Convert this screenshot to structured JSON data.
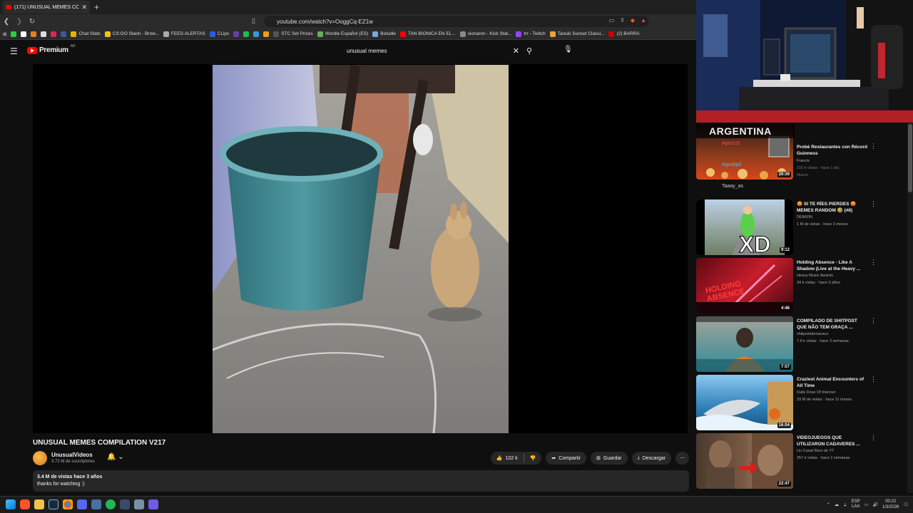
{
  "browser": {
    "tab_title": "(171) UNUSUAL MEMES COM",
    "url": "youtube.com/watch?v=OoggCq-EZ1w",
    "bookmarks": [
      "Chat Stats",
      "CS:GO Stash - Brow...",
      "FEED ALERTAS",
      "CLips",
      "STC Set Prices",
      "Wordle Español (ES)",
      "Boludle",
      "TAN BIONICA EN EL...",
      "sionaron - Kick Stat...",
      "trr - Twitch",
      "Tanuki Sunset Classi...",
      "(2) BARRA"
    ]
  },
  "youtube": {
    "logo_text": "Premium",
    "logo_sup": "AR",
    "search_query": "unusual memes"
  },
  "video": {
    "title": "UNUSUAL MEMES COMPILATION V217",
    "channel": "UnusualVideos",
    "subscribers": "3.72 M de suscriptores",
    "likes": "102 k",
    "share": "Compartir",
    "save": "Guardar",
    "download": "Descargar",
    "views_date": "3.4 M de vistas  hace 3 años",
    "description": "thanks for watching :)"
  },
  "webcam_overlay": {
    "banner": "ARGENTINA",
    "chat_users": [
      "Apto2z2",
      "Agustip0",
      "Taaay_as"
    ]
  },
  "recommendations": [
    {
      "title": "Probé Restaurantes con Récord Guinness",
      "channel": "Francis",
      "meta": "155 k vistas · hace 1 día",
      "badge": "Nuevo",
      "duration": "20:39"
    },
    {
      "title": "😡 SI TE RÍES PIERDES 😡 MEMES RANDOM 🤣 (#8)",
      "channel": "DEIMON",
      "meta": "1 M de vistas · hace 3 meses",
      "duration": "9:12"
    },
    {
      "title": "Holding Absence - Like A Shadow (Live at the Heavy ...",
      "channel": "Heavy Music Awards",
      "meta": "34 k vistas · hace 3 años",
      "duration": "4:46"
    },
    {
      "title": "COMPILADO DE SHITPOST QUE NÃO TEM GRAÇA ...",
      "channel": "shitpostdomacaco",
      "meta": "7.6 k vistas · hace 3 semanas",
      "duration": "7:57"
    },
    {
      "title": "Craziest Animal Encounters of All Time",
      "channel": "Daily Dose Of Internet",
      "meta": "33 M de vistas · hace 11 meses",
      "duration": "16:04"
    },
    {
      "title": "VIDEOJUEGOS QUE UTILIZARON CADAVERES ...",
      "channel": "Un Canal Raro de YT",
      "meta": "257 k vistas · hace 2 semanas",
      "duration": "22:47"
    }
  ],
  "taskbar": {
    "lang_top": "ESP",
    "lang_bottom": "LAA",
    "time": "00:22",
    "date": "1/3/2026"
  }
}
